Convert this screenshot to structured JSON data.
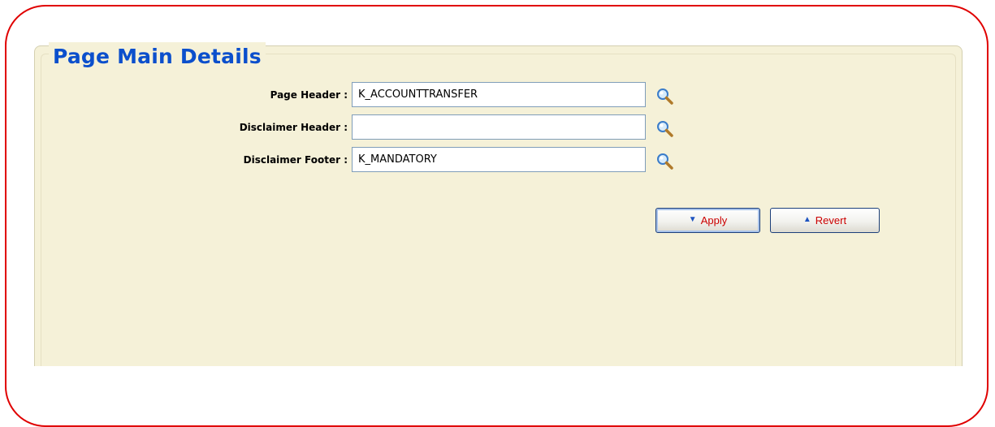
{
  "panel": {
    "title": "Page Main Details"
  },
  "fields": [
    {
      "label": "Page Header :",
      "value": "K_ACCOUNTTRANSFER"
    },
    {
      "label": "Disclaimer Header :",
      "value": ""
    },
    {
      "label": "Disclaimer Footer :",
      "value": "K_MANDATORY"
    }
  ],
  "buttons": {
    "apply_label": "Apply",
    "revert_label": "Revert"
  },
  "icons": {
    "lookup": "magnifier-icon",
    "apply": "triangle-down-icon",
    "revert": "triangle-up-icon"
  },
  "colors": {
    "outline": "#e00000",
    "title": "#0b4fcc",
    "panel_bg": "#f5f1d8",
    "button_text": "#cc0000",
    "button_icon": "#1d53c0"
  }
}
